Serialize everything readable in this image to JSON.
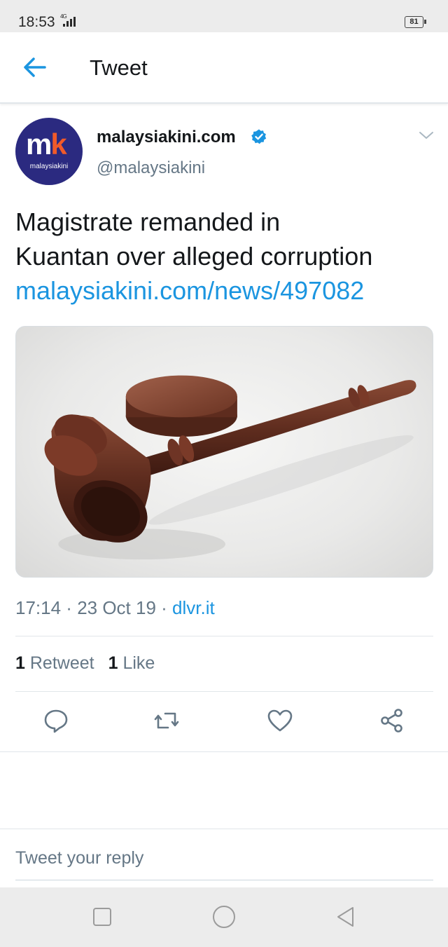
{
  "status": {
    "time": "18:53",
    "network": "4G",
    "battery": "81"
  },
  "header": {
    "title": "Tweet"
  },
  "tweet": {
    "avatar_text_main": "m",
    "avatar_text_accent": "k",
    "avatar_text_sub": "malaysiakini",
    "author_name": "malaysiakini.com",
    "handle": "@malaysiakini",
    "text_line1": "Magistrate remanded in",
    "text_line2": "Kuantan over alleged corruption",
    "link": "malaysiakini.com/news/497082",
    "time": "17:14",
    "date": "23 Oct 19",
    "source": "dlvr.it",
    "separator": " · ",
    "retweet_count": "1",
    "retweet_label": "Retweet",
    "like_count": "1",
    "like_label": "Like"
  },
  "reply": {
    "placeholder": "Tweet your reply"
  },
  "colors": {
    "accent": "#1b95e0",
    "secondary_text": "#657786",
    "avatar_bg": "#2b2a80",
    "brand_orange": "#f15a29"
  }
}
